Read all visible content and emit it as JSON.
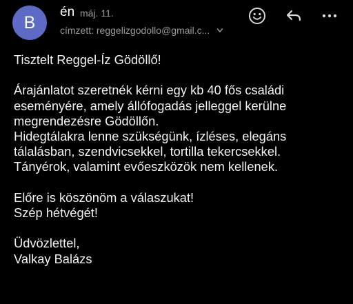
{
  "header": {
    "avatar_initial": "B",
    "sender": "én",
    "date": "máj. 11.",
    "recipient": "címzett: reggelizgodollo@gmail.c..."
  },
  "actions": {
    "emoji_icon": "smiley-icon",
    "reply_icon": "reply-icon",
    "more_icon": "more-icon"
  },
  "message": {
    "greeting": "Tisztelt Reggel-Íz Gödöllő!",
    "para1": [
      "Árajánlatot szeretnék kérni egy kb 40 fős családi",
      "eseményére, amely állófogadás jelleggel kerülne",
      "megrendezésre Gödöllőn.",
      "Hidegtálakra lenne szükségünk, ízléses, elegáns",
      "tálalásban, szendvicsekkel, tortilla tekercsekkel.",
      "Tányérok, valamint evőeszközök nem kellenek."
    ],
    "para2": [
      "Előre is köszönöm a válaszukat!",
      "Szép hétvégét!"
    ],
    "signoff": [
      "Üdvözlettel,",
      "Valkay Balázs"
    ]
  },
  "colors": {
    "background": "#000000",
    "avatar": "#5d6bc7",
    "secondary_text": "#9a9a9a"
  }
}
